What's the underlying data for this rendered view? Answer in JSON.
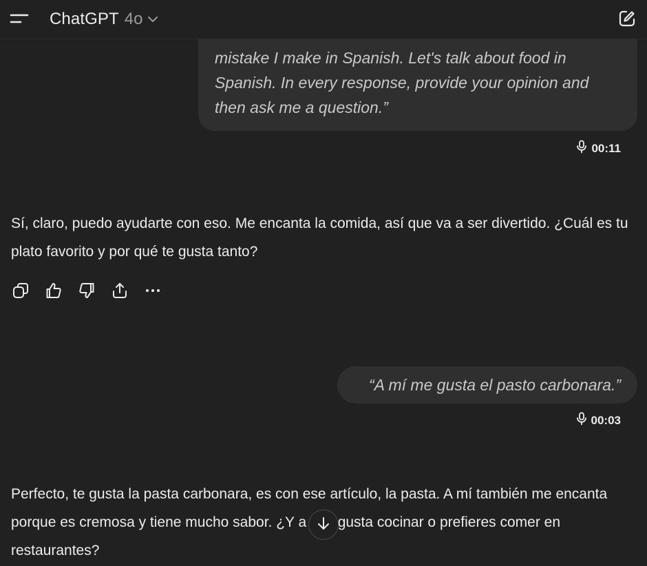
{
  "header": {
    "title": "ChatGPT",
    "model": "4o",
    "menu_icon": "sidebar-menu-icon",
    "new_chat_icon": "compose-icon"
  },
  "messages": {
    "user_1": {
      "text": "mistake I make in Spanish. Let's talk about food in Spanish. In every response, provide your opinion and then ask me a question.”",
      "duration": "00:11"
    },
    "assistant_1": {
      "text": "Sí, claro, puedo ayudarte con eso. Me encanta la comida, así que va a ser divertido. ¿Cuál es tu plato favorito y por qué te gusta tanto?",
      "actions": [
        "copy-icon",
        "thumbs-up-icon",
        "thumbs-down-icon",
        "share-icon",
        "more-icon"
      ]
    },
    "user_2": {
      "text": "“A mí me gusta el pasto carbonara.”",
      "duration": "00:03"
    },
    "assistant_2": {
      "text": "Perfecto, te gusta la pasta carbonara, es con ese artículo, la pasta. A mí también me encanta porque es cremosa y tiene mucho sabor. ¿Y a ti te gusta cocinar o prefieres comer en restaurantes?"
    }
  },
  "colors": {
    "background": "#212121",
    "bubble": "#2f2f2f",
    "text": "#ececec",
    "muted": "#9b9b9b"
  }
}
